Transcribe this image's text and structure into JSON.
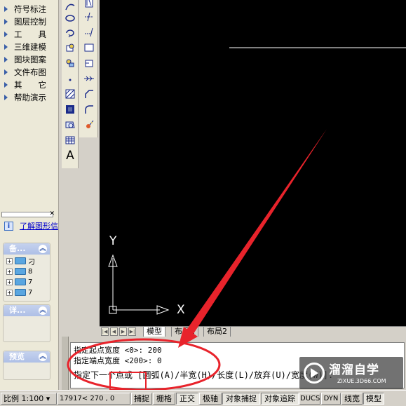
{
  "left_menu": {
    "items": [
      {
        "label": "符号标注"
      },
      {
        "label": "图层控制"
      },
      {
        "label": "工　　具"
      },
      {
        "label": "三维建模"
      },
      {
        "label": "图块图案"
      },
      {
        "label": "文件布图"
      },
      {
        "label": "其　　它"
      },
      {
        "label": "帮助演示"
      }
    ]
  },
  "help_box": {
    "info_icon": "i",
    "link": "了解图形信"
  },
  "panel_backup": {
    "title": "备...",
    "rows": [
      {
        "label": "刁"
      },
      {
        "label": "8"
      },
      {
        "label": "7"
      },
      {
        "label": "7"
      }
    ]
  },
  "panel_detail": {
    "title": "详..."
  },
  "panel_preview": {
    "title": "预览"
  },
  "toolbar": {
    "icons_1": [
      "arc-icon",
      "ellipse-icon",
      "revision-cloud-icon",
      "insert-block-icon",
      "make-block-icon",
      "point-icon",
      "hatch-icon",
      "gradient-icon",
      "region-icon",
      "table-icon",
      "text-icon"
    ],
    "icons_2": [
      "stretch-icon",
      "trim-icon",
      "extend-icon",
      "break-icon",
      "join-icon",
      "move-icon",
      "chamfer-icon",
      "fillet-icon",
      "explode-icon"
    ],
    "text_tool_label": "A"
  },
  "canvas": {
    "ucs_y_label": "Y",
    "ucs_x_label": "X"
  },
  "layout_tabs": [
    {
      "label": "模型",
      "active": true
    },
    {
      "label": "布局1",
      "active": false
    },
    {
      "label": "布局2",
      "active": false
    }
  ],
  "command": {
    "lines": [
      "指定起点宽度 <0>: 200",
      "指定端点宽度 <200>: 0",
      "指定下一个点或 [圆弧(A)/半宽(H)/长度(L)/放弃(U)/宽度(W)]:"
    ]
  },
  "status_bar": {
    "scale": "比例 1:100 ▾",
    "coords": "17917< 270  , 0",
    "toggles": [
      {
        "label": "捕捉",
        "on": false
      },
      {
        "label": "栅格",
        "on": false
      },
      {
        "label": "正交",
        "on": true
      },
      {
        "label": "极轴",
        "on": false
      },
      {
        "label": "对象捕捉",
        "on": true
      },
      {
        "label": "对象追踪",
        "on": true
      },
      {
        "label": "DUCS",
        "on": false
      },
      {
        "label": "DYN",
        "on": false
      },
      {
        "label": "线宽",
        "on": false
      },
      {
        "label": "模型",
        "on": true
      }
    ]
  },
  "watermark": {
    "title": "溜溜自学",
    "subtitle": "ZIXUE.3D66.COM"
  },
  "colors": {
    "canvas_bg": "#000000",
    "annotation_red": "#e8232b",
    "panel_bg": "#ece9d8"
  }
}
